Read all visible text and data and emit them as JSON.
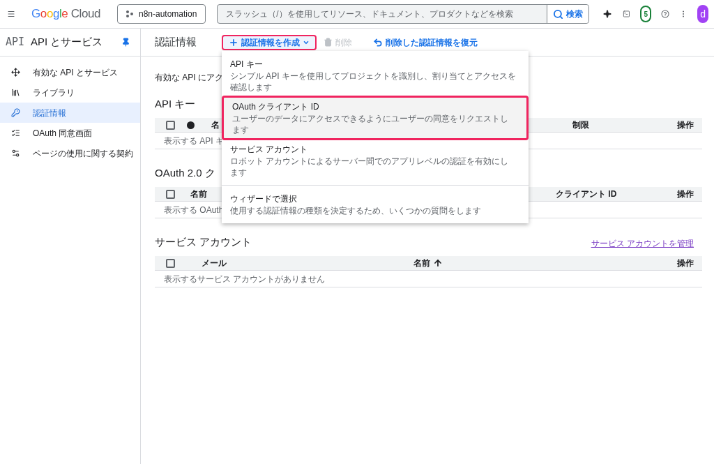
{
  "header": {
    "logo": "Google Cloud",
    "project": "n8n-automation",
    "search": {
      "placeholder": "スラッシュ（/）を使用してリソース、ドキュメント、プロダクトなどを検索",
      "button": "検索"
    },
    "notifications": "5",
    "avatar": "d"
  },
  "sidebar": {
    "badge": "API",
    "title": "API とサービス",
    "items": [
      {
        "label": "有効な API とサービス",
        "selected": false
      },
      {
        "label": "ライブラリ",
        "selected": false
      },
      {
        "label": "認証情報",
        "selected": true
      },
      {
        "label": "OAuth 同意画面",
        "selected": false
      },
      {
        "label": "ページの使用に関する契約",
        "selected": false
      }
    ]
  },
  "toolbar": {
    "title": "認証情報",
    "create_button": {
      "label": "認証情報を作成",
      "annotated": true
    },
    "delete_button": {
      "label": "削除",
      "disabled": true
    },
    "restore_link": "削除した認証情報を復元"
  },
  "intro": "有効な API にアク",
  "sections": [
    {
      "title": "API キー",
      "columns": [
        {
          "kind": "checkbox",
          "checked": false
        },
        {
          "kind": "dot"
        },
        {
          "kind": "text",
          "label": "名"
        },
        {
          "kind": "text",
          "label": "制限"
        },
        {
          "kind": "text",
          "label": "操作"
        }
      ],
      "empty_text": "表示する API キ"
    },
    {
      "title": "OAuth 2.0 ク",
      "columns": [
        {
          "kind": "checkbox",
          "checked": false
        },
        {
          "kind": "text",
          "label": "名前"
        },
        {
          "kind": "text",
          "label": "クライアント ID"
        },
        {
          "kind": "text",
          "label": "操作"
        }
      ],
      "empty_text": "表示する OAuth"
    },
    {
      "title": "サービス アカウント",
      "link": "サービス アカウントを管理",
      "columns": [
        {
          "kind": "checkbox",
          "checked": false
        },
        {
          "kind": "text",
          "label": "メール"
        },
        {
          "kind": "sorted",
          "label": "名前"
        },
        {
          "kind": "text",
          "label": "操作"
        }
      ],
      "empty_text": "表示するサービス アカウントがありません"
    }
  ],
  "menu": [
    {
      "title": "API キー",
      "description": "シンプル API キーを使用してプロジェクトを識別し、割り当てとアクセスを確認します",
      "annotated": false,
      "divider_before": false
    },
    {
      "title": "OAuth クライアント ID",
      "description": "ユーザーのデータにアクセスできるようにユーザーの同意をリクエストします",
      "annotated": true,
      "divider_before": false
    },
    {
      "title": "サービス アカウント",
      "description": "ロボット アカウントによるサーバー間でのアプリレベルの認証を有効にします",
      "annotated": false,
      "divider_before": false
    },
    {
      "title": "ウィザードで選択",
      "description": "使用する認証情報の種類を決定するため、いくつかの質問をします",
      "annotated": false,
      "divider_before": true
    }
  ]
}
